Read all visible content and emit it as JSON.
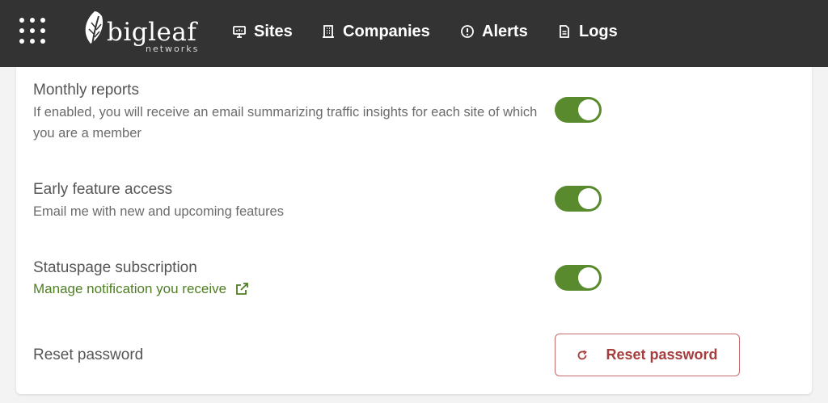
{
  "header": {
    "logo": {
      "word": "bigleaf",
      "sub": "networks"
    },
    "nav": [
      {
        "label": "Sites",
        "icon": "monitor-icon"
      },
      {
        "label": "Companies",
        "icon": "building-icon"
      },
      {
        "label": "Alerts",
        "icon": "alert-circle-icon"
      },
      {
        "label": "Logs",
        "icon": "document-icon"
      }
    ]
  },
  "settings": {
    "monthly_reports": {
      "title": "Monthly reports",
      "description": "If enabled, you will receive an email summarizing traffic insights for each site of which you are a member",
      "enabled": true
    },
    "early_access": {
      "title": "Early feature access",
      "description": "Email me with new and upcoming features",
      "enabled": true
    },
    "statuspage": {
      "title": "Statuspage subscription",
      "link_label": "Manage notification you receive",
      "enabled": true
    },
    "reset_password": {
      "title": "Reset password",
      "button_label": "Reset password"
    }
  },
  "colors": {
    "topbar": "#333333",
    "toggle_on": "#5a8a2e",
    "link": "#4f7e24",
    "danger": "#a73d3d"
  }
}
